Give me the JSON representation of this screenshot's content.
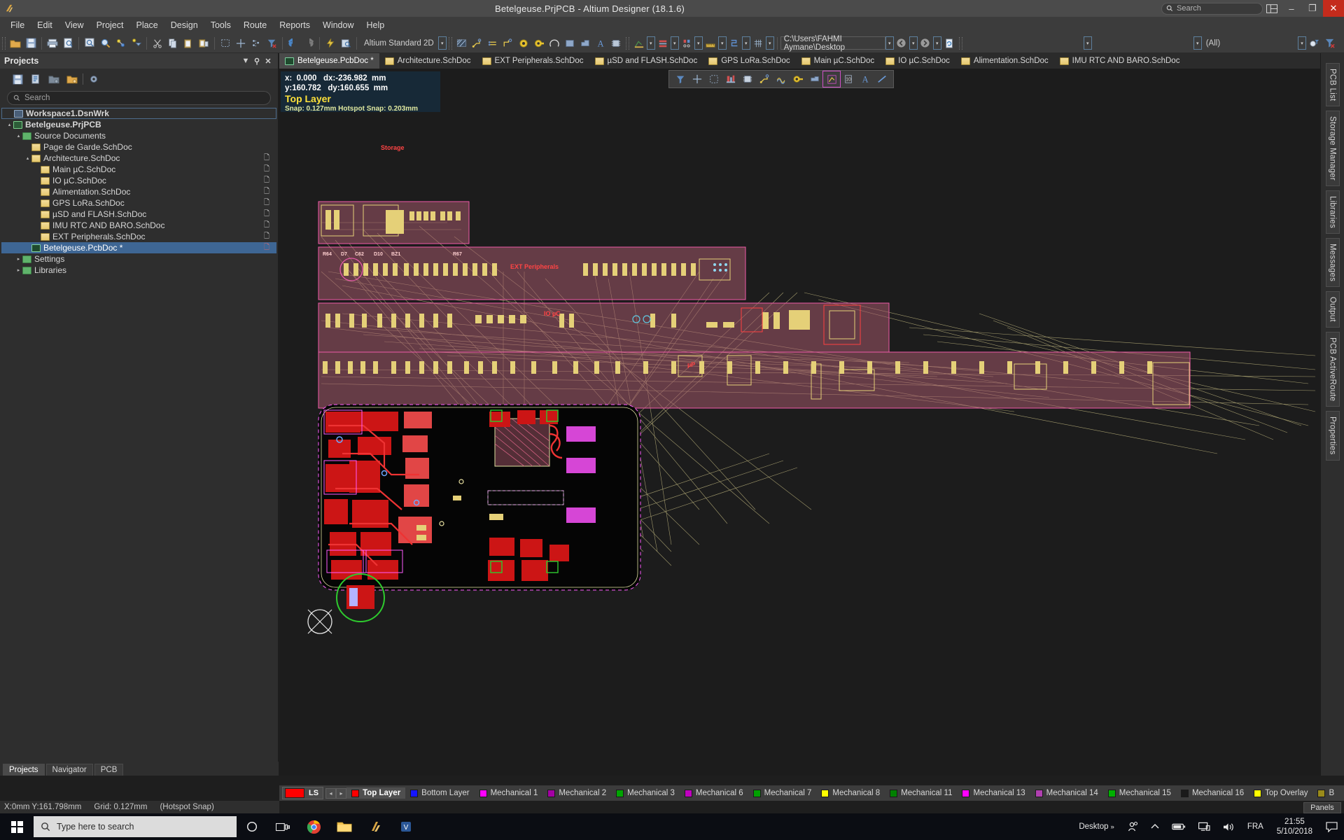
{
  "titlebar": {
    "title": "Betelgeuse.PrjPCB - Altium Designer (18.1.6)",
    "search_placeholder": "Search",
    "app_icon": "altium-icon",
    "minimize": "–",
    "maximize": "❐",
    "close": "✕"
  },
  "menu": [
    "File",
    "Edit",
    "View",
    "Project",
    "Place",
    "Design",
    "Tools",
    "Route",
    "Reports",
    "Window",
    "Help"
  ],
  "toolbar": {
    "workspace_label": "Altium Standard 2D",
    "path_value": "C:\\Users\\FAHMI Aymane\\Desktop",
    "filter_all": "(All)",
    "icons": [
      "open-folder-icon",
      "save-icon",
      "print-icon",
      "print-preview-icon",
      "zoom-area-icon",
      "zoom-icon",
      "cross-probe-icon",
      "cross-select-icon",
      "cut-icon",
      "copy-icon",
      "paste-icon",
      "paste-array-icon",
      "select-area-icon",
      "move-icon",
      "align-icon",
      "clear-filter-icon",
      "undo-icon",
      "redo-icon",
      "compile-icon",
      "browse-icon"
    ],
    "icons2": [
      "polygon-pour-icon",
      "route-icon",
      "differential-pair-icon",
      "interactive-route-icon",
      "via-icon",
      "pad-icon",
      "arc-icon",
      "fill-icon",
      "region-icon",
      "string-icon",
      "component-icon",
      "dimension-icon",
      "layer-stack-icon",
      "drc-icon",
      "ruler-icon",
      "netlist-icon",
      "grid-icon"
    ]
  },
  "projects_panel": {
    "title": "Projects",
    "head_icons": [
      "chevron-down-icon",
      "pin-icon",
      "close-icon"
    ],
    "tool_icons": [
      "save-all-icon",
      "compile-icon",
      "open-project-icon",
      "project-options-icon",
      "settings-gear-icon"
    ],
    "search_placeholder": "Search",
    "tree": [
      {
        "indent": 0,
        "twisty": "",
        "icon": "ic-wsp",
        "label": "Workspace1.DsnWrk",
        "doc": "",
        "boxed": true,
        "bold": true
      },
      {
        "indent": 0,
        "twisty": "▴",
        "icon": "ic-prj",
        "label": "Betelgeuse.PrjPCB",
        "doc": "",
        "bold": true
      },
      {
        "indent": 1,
        "twisty": "▴",
        "icon": "ic-folder",
        "label": "Source Documents",
        "doc": ""
      },
      {
        "indent": 2,
        "twisty": "",
        "icon": "ic-sch",
        "label": "Page de Garde.SchDoc",
        "doc": ""
      },
      {
        "indent": 2,
        "twisty": "▴",
        "icon": "ic-sch",
        "label": "Architecture.SchDoc",
        "doc": "page"
      },
      {
        "indent": 3,
        "twisty": "",
        "icon": "ic-sch",
        "label": "Main µC.SchDoc",
        "doc": "page"
      },
      {
        "indent": 3,
        "twisty": "",
        "icon": "ic-sch",
        "label": "IO µC.SchDoc",
        "doc": "page"
      },
      {
        "indent": 3,
        "twisty": "",
        "icon": "ic-sch",
        "label": "Alimentation.SchDoc",
        "doc": "page"
      },
      {
        "indent": 3,
        "twisty": "",
        "icon": "ic-sch",
        "label": "GPS LoRa.SchDoc",
        "doc": "page"
      },
      {
        "indent": 3,
        "twisty": "",
        "icon": "ic-sch",
        "label": "µSD and FLASH.SchDoc",
        "doc": "page"
      },
      {
        "indent": 3,
        "twisty": "",
        "icon": "ic-sch",
        "label": "IMU RTC AND BARO.SchDoc",
        "doc": "page"
      },
      {
        "indent": 3,
        "twisty": "",
        "icon": "ic-sch",
        "label": "EXT Peripherals.SchDoc",
        "doc": "page"
      },
      {
        "indent": 2,
        "twisty": "",
        "icon": "ic-pcb",
        "label": "Betelgeuse.PcbDoc *",
        "doc": "page-red",
        "selected": true
      },
      {
        "indent": 1,
        "twisty": "▸",
        "icon": "ic-folder",
        "label": "Settings",
        "doc": ""
      },
      {
        "indent": 1,
        "twisty": "▸",
        "icon": "ic-folder",
        "label": "Libraries",
        "doc": ""
      }
    ],
    "bottom_tabs": [
      "Projects",
      "Navigator",
      "PCB"
    ],
    "active_bottom_tab": "Projects"
  },
  "editor_tabs": [
    {
      "label": "Betelgeuse.PcbDoc *",
      "icon": "pcb-icon",
      "active": true
    },
    {
      "label": "Architecture.SchDoc",
      "icon": "sch-icon",
      "active": false
    },
    {
      "label": "EXT Peripherals.SchDoc",
      "icon": "sch-icon",
      "active": false
    },
    {
      "label": "µSD and FLASH.SchDoc",
      "icon": "sch-icon",
      "active": false
    },
    {
      "label": "GPS LoRa.SchDoc",
      "icon": "sch-icon",
      "active": false
    },
    {
      "label": "Main µC.SchDoc",
      "icon": "sch-icon",
      "active": false
    },
    {
      "label": "IO µC.SchDoc",
      "icon": "sch-icon",
      "active": false
    },
    {
      "label": "Alimentation.SchDoc",
      "icon": "sch-icon",
      "active": false
    },
    {
      "label": "IMU RTC AND BARO.SchDoc",
      "icon": "sch-icon",
      "active": false
    }
  ],
  "canvas_overlay": {
    "x_label": "x:",
    "x_value": "0.000",
    "dx_label": "dx:",
    "dx_value": "-236.982",
    "dx_unit": "mm",
    "y_label": "y:",
    "y_value": "160.782",
    "dy_label": "dy:",
    "dy_value": "160.655",
    "dy_unit": "mm",
    "layer": "Top Layer",
    "snap": "Snap: 0.127mm Hotspot Snap: 0.203mm"
  },
  "float_toolbar": {
    "icons": [
      "filter-funnel-icon",
      "crosshair-icon",
      "select-region-icon",
      "layer-stack-icon",
      "component-icon",
      "route-net-icon",
      "differential-pair-route-icon",
      "via-icon",
      "fill-icon",
      "region-polygon-icon",
      "dimension-icon",
      "text-string-icon",
      "line-icon"
    ]
  },
  "pcb_rooms": [
    {
      "name": "Storage"
    },
    {
      "name": "EXT Peripherals"
    },
    {
      "name": "IO µC"
    },
    {
      "name": "µP"
    }
  ],
  "pcb_designators": [
    "R64",
    "D7",
    "C62",
    "D10",
    "BZ1",
    "R67"
  ],
  "layer_bar": {
    "ls_label": "LS",
    "prev": "◂",
    "next": "▸",
    "layers": [
      {
        "name": "Top Layer",
        "color": "#ff0000",
        "active": true
      },
      {
        "name": "Bottom Layer",
        "color": "#1515ff",
        "active": false
      },
      {
        "name": "Mechanical 1",
        "color": "#ff00ff",
        "active": false
      },
      {
        "name": "Mechanical 2",
        "color": "#a400a4",
        "active": false
      },
      {
        "name": "Mechanical 3",
        "color": "#00a400",
        "active": false
      },
      {
        "name": "Mechanical 6",
        "color": "#c000c0",
        "active": false
      },
      {
        "name": "Mechanical 7",
        "color": "#00a000",
        "active": false
      },
      {
        "name": "Mechanical 8",
        "color": "#ffff00",
        "active": false
      },
      {
        "name": "Mechanical 11",
        "color": "#008000",
        "active": false
      },
      {
        "name": "Mechanical 13",
        "color": "#ff00ff",
        "active": false
      },
      {
        "name": "Mechanical 14",
        "color": "#b040b0",
        "active": false
      },
      {
        "name": "Mechanical 15",
        "color": "#00b000",
        "active": false
      },
      {
        "name": "Mechanical 16",
        "color": "#1a1a1a",
        "active": false
      },
      {
        "name": "Top Overlay",
        "color": "#ffff00",
        "active": false
      },
      {
        "name": "B",
        "color": "#9a8b1a",
        "active": false
      }
    ]
  },
  "status_bar": {
    "coords": "X:0mm Y:161.798mm",
    "grid": "Grid: 0.127mm",
    "snap_mode": "(Hotspot Snap)"
  },
  "right_tabs": [
    "PCB List",
    "Storage Manager",
    "Libraries",
    "Messages",
    "Output",
    "PCB ActiveRoute",
    "Properties"
  ],
  "panels_button": "Panels",
  "taskbar": {
    "search_placeholder": "Type here to search",
    "icons": [
      "cortana-icon",
      "task-view-icon",
      "chrome-icon",
      "file-explorer-icon",
      "altium-icon",
      "visio-icon"
    ],
    "desktop_label": "Desktop",
    "overflow": "»",
    "tray": [
      "people-icon",
      "show-hidden-icon",
      "battery-icon",
      "network-icon",
      "volume-icon"
    ],
    "language": "FRA",
    "time": "21:55",
    "date": "5/10/2018",
    "action_center": "notification-icon"
  }
}
